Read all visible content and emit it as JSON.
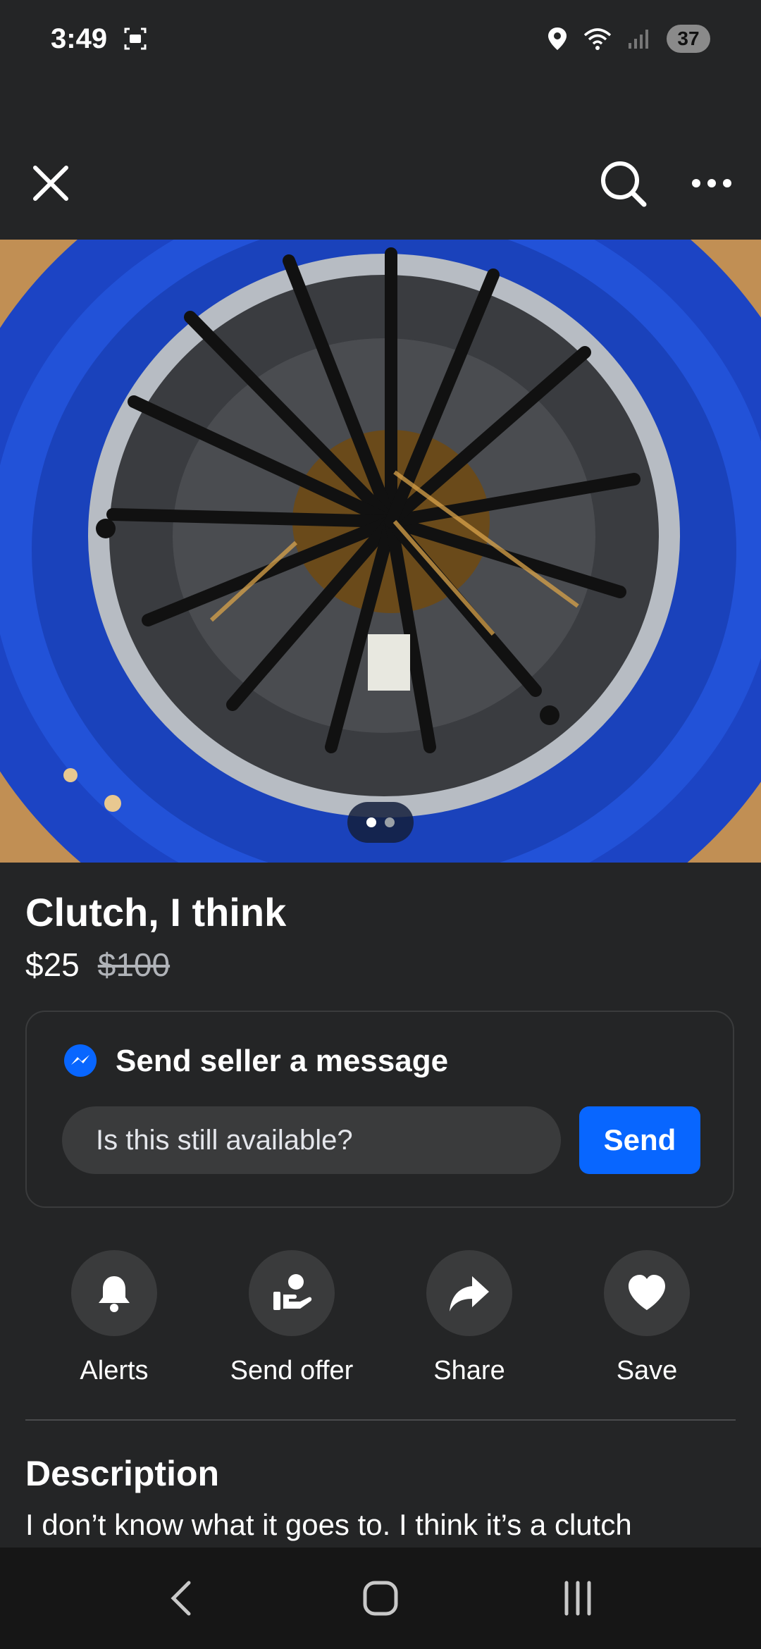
{
  "status_bar": {
    "time": "3:49",
    "battery": "37"
  },
  "listing": {
    "title": "Clutch, I think",
    "price": "$25",
    "original_price": "$100",
    "image_pages": 2,
    "current_image": 1
  },
  "message": {
    "heading": "Send seller a message",
    "input_value": "Is this still available?",
    "send_label": "Send"
  },
  "actions": [
    {
      "label": "Alerts",
      "icon": "bell-icon"
    },
    {
      "label": "Send offer",
      "icon": "offer-hand-icon"
    },
    {
      "label": "Share",
      "icon": "share-arrow-icon"
    },
    {
      "label": "Save",
      "icon": "heart-icon"
    }
  ],
  "description": {
    "heading": "Description",
    "text": "I don’t know what it goes to. I think it’s a clutch"
  },
  "colors": {
    "accent": "#0866ff",
    "background": "#242526"
  }
}
